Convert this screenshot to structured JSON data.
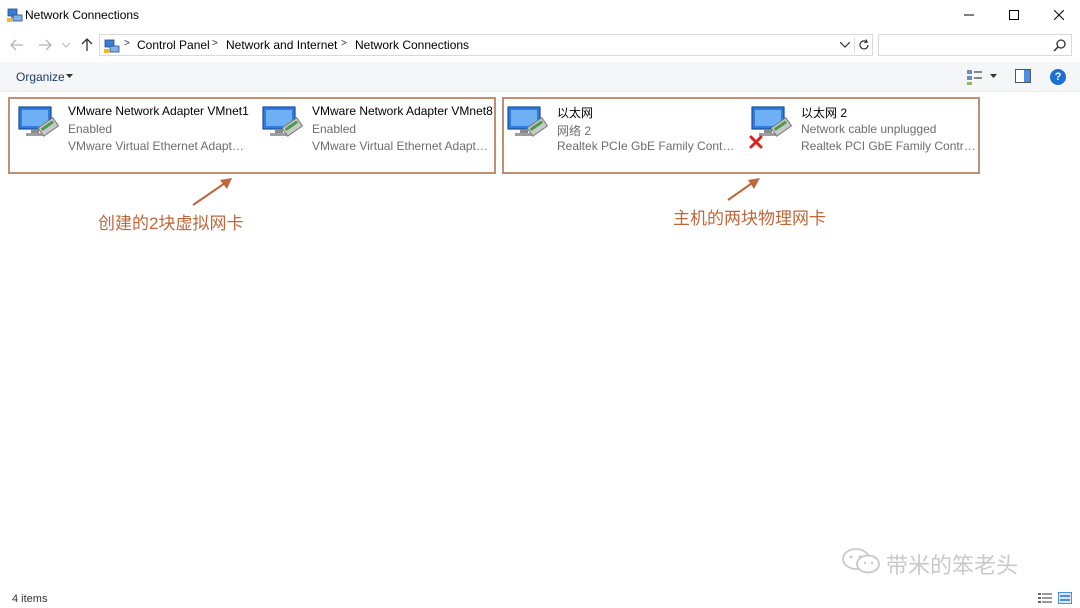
{
  "window": {
    "title": "Network Connections",
    "minimize_glyph": "—",
    "maximize_glyph": "☐",
    "close_glyph": "✕"
  },
  "address_bar": {
    "breadcrumbs": [
      "Control Panel",
      "Network and Internet",
      "Network Connections"
    ],
    "separator": ">",
    "search_placeholder": ""
  },
  "toolbar": {
    "organize_label": "Organize",
    "help_label": "?"
  },
  "connections": [
    {
      "name": "VMware Network Adapter VMnet1",
      "status": "Enabled",
      "device": "VMware Virtual Ethernet Adapter ...",
      "disconnected": false
    },
    {
      "name": "VMware Network Adapter VMnet8",
      "status": "Enabled",
      "device": "VMware Virtual Ethernet Adapter ...",
      "disconnected": false
    },
    {
      "name": "以太网",
      "status": "网络 2",
      "device": "Realtek PCIe GbE Family Controller",
      "disconnected": false
    },
    {
      "name": "以太网 2",
      "status": "Network cable unplugged",
      "device": "Realtek PCI GbE Family Controller",
      "disconnected": true
    }
  ],
  "annotations": {
    "virtual_label": "创建的2块虚拟网卡",
    "physical_label": "主机的两块物理网卡",
    "color": "#c0673a",
    "box_color": "#c08f74"
  },
  "watermark": {
    "text": "带米的笨老头"
  },
  "status_bar": {
    "item_count": "4 items"
  },
  "icons": {
    "app": "network-connections-icon",
    "adapter": "network-adapter-icon",
    "disconnected": "red-x-icon"
  }
}
